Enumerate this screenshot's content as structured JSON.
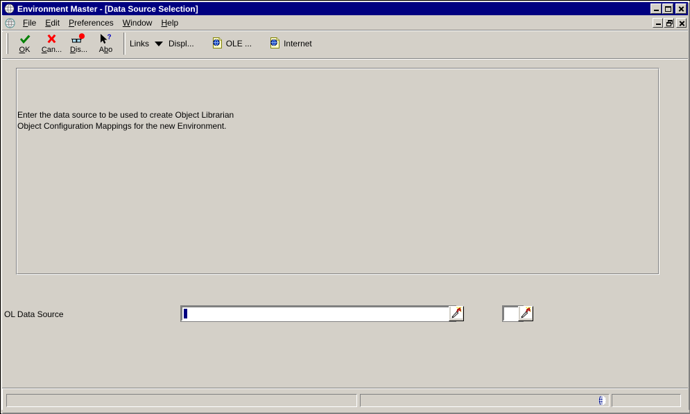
{
  "window": {
    "title": "Environment Master - [Data Source Selection]",
    "app_icon": "globe-icon",
    "buttons": {
      "minimize": "minimize",
      "maximize": "maximize",
      "close": "close"
    }
  },
  "mdi": {
    "icon": "globe-icon",
    "buttons": {
      "minimize": "minimize",
      "restore": "restore",
      "close": "close"
    }
  },
  "menu": {
    "items": [
      {
        "label": "File",
        "accel": "F"
      },
      {
        "label": "Edit",
        "accel": "E"
      },
      {
        "label": "Preferences",
        "accel": "P"
      },
      {
        "label": "Window",
        "accel": "W"
      },
      {
        "label": "Help",
        "accel": "H"
      }
    ]
  },
  "toolbar": {
    "buttons": [
      {
        "label": "OK",
        "accel": "O",
        "icon": "green-check-icon"
      },
      {
        "label": "Can...",
        "accel": "C",
        "icon": "red-x-icon"
      },
      {
        "label": "Dis...",
        "accel": "D",
        "icon": "glasses-balloon-icon"
      },
      {
        "label": "Abo",
        "accel": "b",
        "icon": "cursor-question-icon"
      }
    ],
    "links_label": "Links",
    "display_label": "Displ...",
    "ole_label": "OLE ...",
    "internet_label": "Internet",
    "ole_icon": "document-globe-icon",
    "internet_icon": "document-globe-icon",
    "caret_icon": "chevron-down-icon"
  },
  "form": {
    "instruction_line1": "Enter the data source to be used to create Object Librarian",
    "instruction_line2": "Object Configuration Mappings for the new Environment.",
    "ol_data_source": {
      "label": "OL Data Source",
      "value": "",
      "placeholder": "",
      "assist_icon": "flashlight-icon"
    },
    "ol_data_source_secondary": {
      "value": "",
      "placeholder": "",
      "assist_icon": "flashlight-icon"
    }
  },
  "statusbar": {
    "pane1": "",
    "pane2": "",
    "pane3": "",
    "globe_icon": "globe-icon"
  },
  "colors": {
    "titlebar": "#000080",
    "face": "#d4d0c8",
    "shadow": "#808080",
    "highlight": "#ffffff",
    "text": "#000000",
    "caret": "#000080",
    "ok_green": "#008000",
    "cancel_red": "#ff0000"
  }
}
